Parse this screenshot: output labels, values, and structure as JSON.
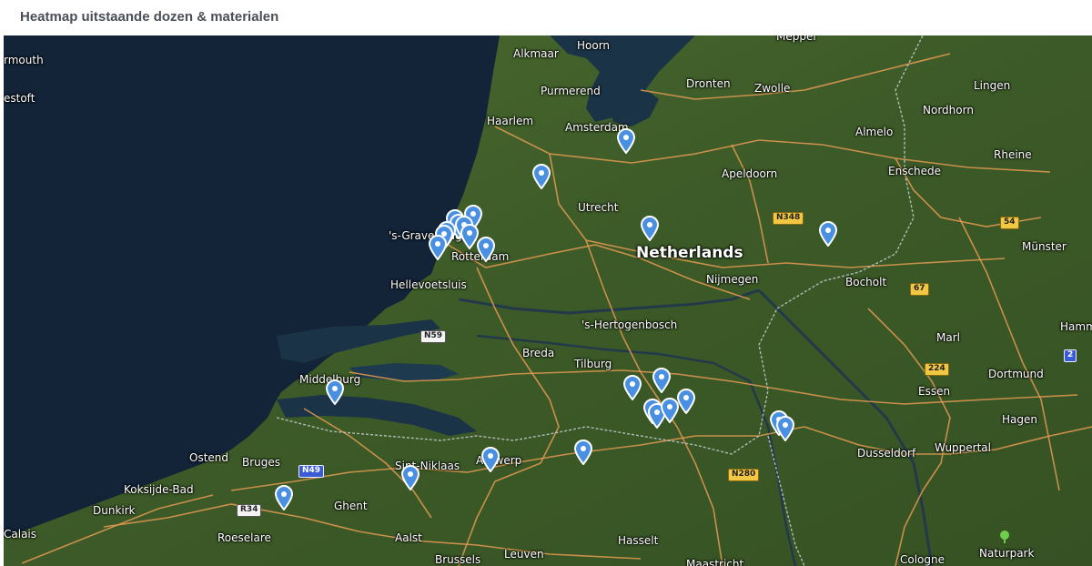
{
  "header": {
    "title": "Heatmap uitstaande dozen & materialen"
  },
  "map": {
    "colors": {
      "sea": "#132338",
      "land": "#3f5d2a",
      "marker": "#4a90e2",
      "road": "#e39a52"
    },
    "labels": [
      {
        "id": "label-yarmouth",
        "text": "rmouth",
        "size": "normal"
      },
      {
        "id": "label-lowestoft",
        "text": "estoft",
        "size": "normal"
      },
      {
        "id": "label-hoorn",
        "text": "Hoorn",
        "size": "normal"
      },
      {
        "id": "label-alkmaar",
        "text": "Alkmaar",
        "size": "normal"
      },
      {
        "id": "label-purmerend",
        "text": "Purmerend",
        "size": "normal"
      },
      {
        "id": "label-haarlem",
        "text": "Haarlem",
        "size": "normal"
      },
      {
        "id": "label-amsterdam",
        "text": "Amsterdam",
        "size": "normal"
      },
      {
        "id": "label-dronten",
        "text": "Dronten",
        "size": "normal"
      },
      {
        "id": "label-zwolle",
        "text": "Zwolle",
        "size": "normal"
      },
      {
        "id": "label-meppel",
        "text": "Meppel",
        "size": "normal"
      },
      {
        "id": "label-lingen",
        "text": "Lingen",
        "size": "normal"
      },
      {
        "id": "label-nordhorn",
        "text": "Nordhorn",
        "size": "normal"
      },
      {
        "id": "label-almelo",
        "text": "Almelo",
        "size": "normal"
      },
      {
        "id": "label-rheine",
        "text": "Rheine",
        "size": "normal"
      },
      {
        "id": "label-enschede",
        "text": "Enschede",
        "size": "normal"
      },
      {
        "id": "label-apeldoorn",
        "text": "Apeldoorn",
        "size": "normal"
      },
      {
        "id": "label-utrecht",
        "text": "Utrecht",
        "size": "normal"
      },
      {
        "id": "label-s-gravenhage",
        "text": "'s-Gravenhage",
        "size": "normal"
      },
      {
        "id": "label-rotterdam",
        "text": "Rotterdam",
        "size": "normal"
      },
      {
        "id": "label-netherlands",
        "text": "Netherlands",
        "size": "big"
      },
      {
        "id": "label-munster",
        "text": "Münster",
        "size": "normal"
      },
      {
        "id": "label-nijmegen",
        "text": "Nijmegen",
        "size": "normal"
      },
      {
        "id": "label-bocholt",
        "text": "Bocholt",
        "size": "normal"
      },
      {
        "id": "label-hellevoetsluis",
        "text": "Hellevoetsluis",
        "size": "normal"
      },
      {
        "id": "label-s-hertogenbosch",
        "text": "'s-Hertogenbosch",
        "size": "normal"
      },
      {
        "id": "label-marl",
        "text": "Marl",
        "size": "normal"
      },
      {
        "id": "label-hamm",
        "text": "Hamm",
        "size": "normal"
      },
      {
        "id": "label-breda",
        "text": "Breda",
        "size": "normal"
      },
      {
        "id": "label-tilburg",
        "text": "Tilburg",
        "size": "normal"
      },
      {
        "id": "label-middelburg",
        "text": "Middelburg",
        "size": "normal"
      },
      {
        "id": "label-dortmund",
        "text": "Dortmund",
        "size": "normal"
      },
      {
        "id": "label-essen",
        "text": "Essen",
        "size": "normal"
      },
      {
        "id": "label-hagen",
        "text": "Hagen",
        "size": "normal"
      },
      {
        "id": "label-ostend",
        "text": "Ostend",
        "size": "normal"
      },
      {
        "id": "label-bruges",
        "text": "Bruges",
        "size": "normal"
      },
      {
        "id": "label-koksijde-bad",
        "text": "Koksijde-Bad",
        "size": "normal"
      },
      {
        "id": "label-sint-niklaas",
        "text": "Sint-Niklaas",
        "size": "normal"
      },
      {
        "id": "label-antwerp",
        "text": "Antwerp",
        "size": "normal"
      },
      {
        "id": "label-dusseldorf",
        "text": "Dusseldorf",
        "size": "normal"
      },
      {
        "id": "label-wuppertal",
        "text": "Wuppertal",
        "size": "normal"
      },
      {
        "id": "label-dunkirk",
        "text": "Dunkirk",
        "size": "normal"
      },
      {
        "id": "label-ghent",
        "text": "Ghent",
        "size": "normal"
      },
      {
        "id": "label-calais",
        "text": "Calais",
        "size": "normal"
      },
      {
        "id": "label-roeselare",
        "text": "Roeselare",
        "size": "normal"
      },
      {
        "id": "label-aalst",
        "text": "Aalst",
        "size": "normal"
      },
      {
        "id": "label-brussels",
        "text": "Brussels",
        "size": "normal"
      },
      {
        "id": "label-leuven",
        "text": "Leuven",
        "size": "normal"
      },
      {
        "id": "label-hasselt",
        "text": "Hasselt",
        "size": "normal"
      },
      {
        "id": "label-maastricht",
        "text": "Maastricht",
        "size": "normal"
      },
      {
        "id": "label-cologne",
        "text": "Cologne",
        "size": "normal"
      },
      {
        "id": "label-naturpark",
        "text": "Naturpark",
        "size": "normal"
      }
    ],
    "shields": [
      {
        "id": "shield-n348",
        "text": "N348",
        "style": "yellow"
      },
      {
        "id": "shield-54",
        "text": "54",
        "style": "yellow"
      },
      {
        "id": "shield-67",
        "text": "67",
        "style": "yellow"
      },
      {
        "id": "shield-n59",
        "text": "N59",
        "style": "white"
      },
      {
        "id": "shield-224",
        "text": "224",
        "style": "yellow"
      },
      {
        "id": "shield-2",
        "text": "2",
        "style": "blue"
      },
      {
        "id": "shield-n49",
        "text": "N49",
        "style": "blue"
      },
      {
        "id": "shield-n280",
        "text": "N280",
        "style": "yellow"
      },
      {
        "id": "shield-r34",
        "text": "R34",
        "style": "white"
      }
    ],
    "marker_count": 27
  }
}
